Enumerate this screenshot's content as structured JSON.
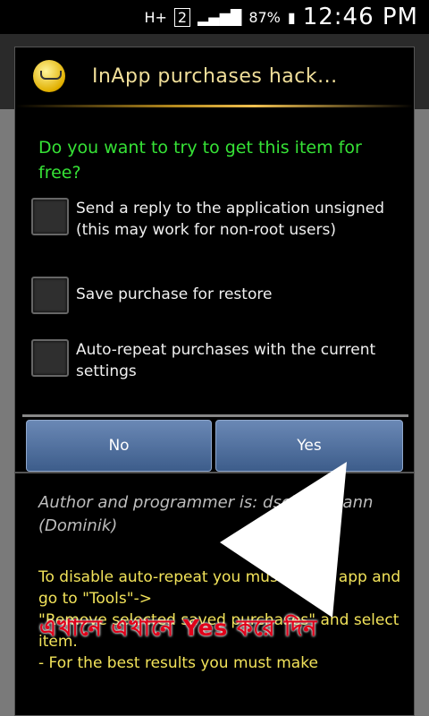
{
  "status_bar": {
    "network": "H+",
    "sim": "2",
    "battery": "87%",
    "time": "12:46 PM"
  },
  "dialog": {
    "title": "InApp purchases hack...",
    "question": "Do you want to try to get this item for free?",
    "options": [
      {
        "label": "Send a reply to the application unsigned (this may work for non-root users)",
        "checked": false
      },
      {
        "label": "Save purchase for restore",
        "checked": false
      },
      {
        "label": "Auto-repeat purchases with the current settings",
        "checked": false
      }
    ],
    "buttons": {
      "no": "No",
      "yes": "Yes"
    },
    "author": "Author and programmer is: dschuermann (Dominik)",
    "note": "To disable auto-repeat you must select app and go to \"Tools\"->\n\"Remove selected saved purchases\" and select item.\n- For the best results you must make"
  },
  "overlay": {
    "text": "এখানে এখানে Yes করে দিন",
    "arrow_color": "#ffffff",
    "text_color": "#e0001a"
  },
  "colors": {
    "question": "#36e236",
    "title": "#f1df9a",
    "note": "#f2e35a",
    "button": "#4f6f9f"
  }
}
